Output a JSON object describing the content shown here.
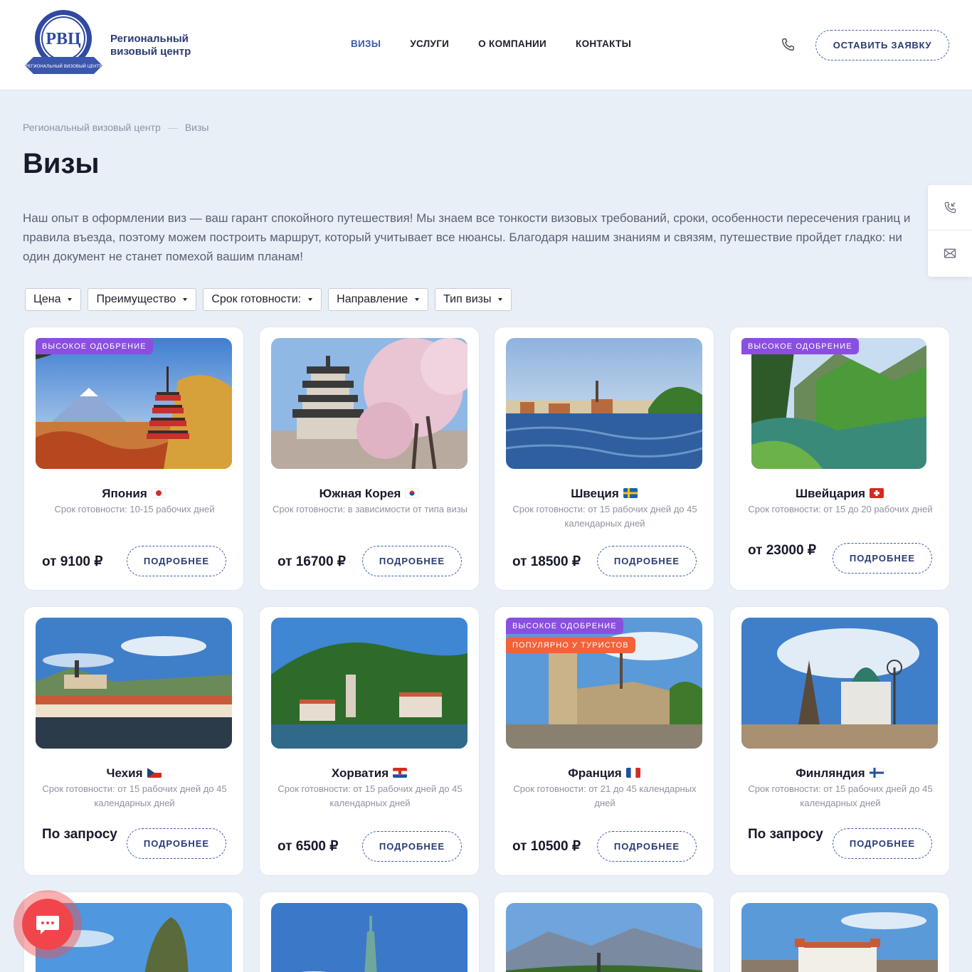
{
  "header": {
    "brand_line1": "Региональный",
    "brand_line2": "визовый центр",
    "logo_text": "РВЦ",
    "logo_ribbon": "РЕГИОНАЛЬНЫЙ ВИЗОВЫЙ ЦЕНТР",
    "nav": [
      "ВИЗЫ",
      "УСЛУГИ",
      "О КОМПАНИИ",
      "КОНТАКТЫ"
    ],
    "cta": "ОСТАВИТЬ ЗАЯВКУ"
  },
  "breadcrumb": [
    "Региональный визовый центр",
    "Визы"
  ],
  "page_title": "Визы",
  "intro": "Наш опыт в оформлении виз — ваш гарант спокойного путешествия! Мы знаем все тонкости визовых требований, сроки, особенности пересечения границ и правила въезда, поэтому можем построить маршрут, который учитывает все нюансы. Благодаря нашим знаниям и связям, путешествие пройдет гладко: ни один документ не станет помехой вашим планам!",
  "filters": [
    "Цена",
    "Преимущество",
    "Срок готовности:",
    "Направление",
    "Тип визы"
  ],
  "more_label": "ПОДРОБНЕЕ",
  "badges": {
    "high": "ВЫСОКОЕ ОДОБРЕНИЕ",
    "popular": "ПОПУЛЯРНО У ТУРИСТОВ"
  },
  "cards": [
    {
      "country": "Япония",
      "term": "Срок готовности: 10-15 рабочих дней",
      "price": "от 9100 ₽"
    },
    {
      "country": "Южная Корея",
      "term": "Срок готовности: в зависимости от типа визы",
      "price": "от 16700 ₽"
    },
    {
      "country": "Швеция",
      "term": "Срок готовности: от 15 рабочих дней до 45 календарных дней",
      "price": "от 18500 ₽"
    },
    {
      "country": "Швейцария",
      "term": "Срок готовности: от 15 до 20 рабочих дней",
      "price": "от 23000 ₽"
    },
    {
      "country": "Чехия",
      "term": "Срок готовности: от 15 рабочих дней до 45 календарных дней",
      "price": "По запросу"
    },
    {
      "country": "Хорватия",
      "term": "Срок готовности: от 15 рабочих дней до 45 календарных дней",
      "price": "от 6500 ₽"
    },
    {
      "country": "Франция",
      "term": "Срок готовности: от 21 до 45 календарных дней",
      "price": "от 10500 ₽"
    },
    {
      "country": "Финляндия",
      "term": "Срок готовности: от 15 рабочих дней до 45 календарных дней",
      "price": "По запросу"
    }
  ],
  "colors": {
    "accent": "#3c5aa6",
    "badge_purple": "#8a4fe0",
    "badge_orange": "#f2623b",
    "chat": "#f0464b"
  }
}
